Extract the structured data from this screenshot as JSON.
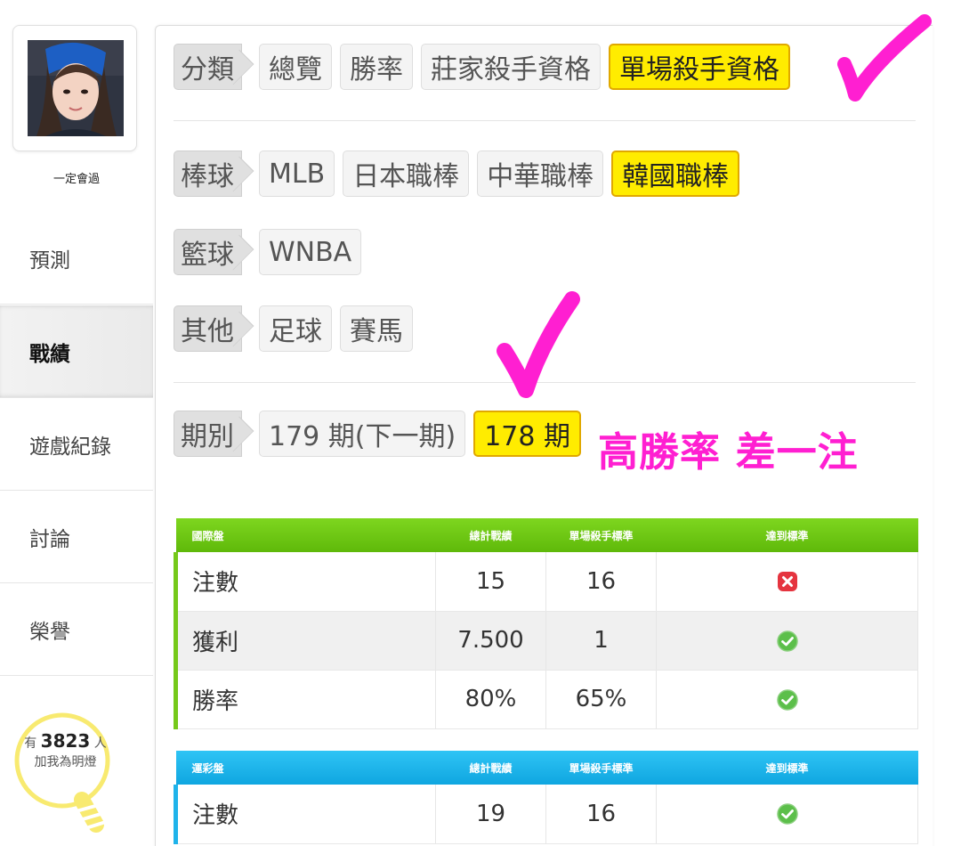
{
  "sidebar": {
    "username": "一定會過",
    "nav": [
      "預測",
      "戰績",
      "遊戲紀錄",
      "討論",
      "榮譽"
    ],
    "active_index": 1,
    "bulb": {
      "prefix": "有",
      "count": "3823",
      "suffix": "人",
      "caption": "加我為明燈"
    }
  },
  "filters": {
    "category": {
      "label": "分類",
      "options": [
        "總覽",
        "勝率",
        "莊家殺手資格",
        "單場殺手資格"
      ],
      "selected": "單場殺手資格"
    },
    "baseball": {
      "label": "棒球",
      "options": [
        "MLB",
        "日本職棒",
        "中華職棒",
        "韓國職棒"
      ],
      "selected": "韓國職棒"
    },
    "basketball": {
      "label": "籃球",
      "options": [
        "WNBA"
      ]
    },
    "other": {
      "label": "其他",
      "options": [
        "足球",
        "賽馬"
      ]
    },
    "period": {
      "label": "期別",
      "options": [
        "179 期(下一期)",
        "178 期"
      ],
      "selected": "178 期"
    }
  },
  "annotation": {
    "text": "高勝率 差一注",
    "color": "#ff1fd1"
  },
  "tables": [
    {
      "headers": [
        "國際盤",
        "總計戰績",
        "單場殺手標準",
        "達到標準"
      ],
      "rows": [
        {
          "name": "注數",
          "total": "15",
          "standard": "16",
          "status": "fail"
        },
        {
          "name": "獲利",
          "total": "7.500",
          "standard": "1",
          "status": "pass"
        },
        {
          "name": "勝率",
          "total": "80%",
          "standard": "65%",
          "status": "pass"
        }
      ]
    },
    {
      "headers": [
        "運彩盤",
        "總計戰績",
        "單場殺手標準",
        "達到標準"
      ],
      "rows": [
        {
          "name": "注數",
          "total": "19",
          "standard": "16",
          "status": "pass"
        }
      ]
    }
  ],
  "colors": {
    "selected": "#ffec00",
    "table1_header": "#6cc414",
    "table2_header": "#1cb4ea",
    "pass": "#5cbf4a",
    "fail": "#e5343f"
  },
  "icons": {
    "pass": "check-circle-icon",
    "fail": "x-square-icon"
  }
}
